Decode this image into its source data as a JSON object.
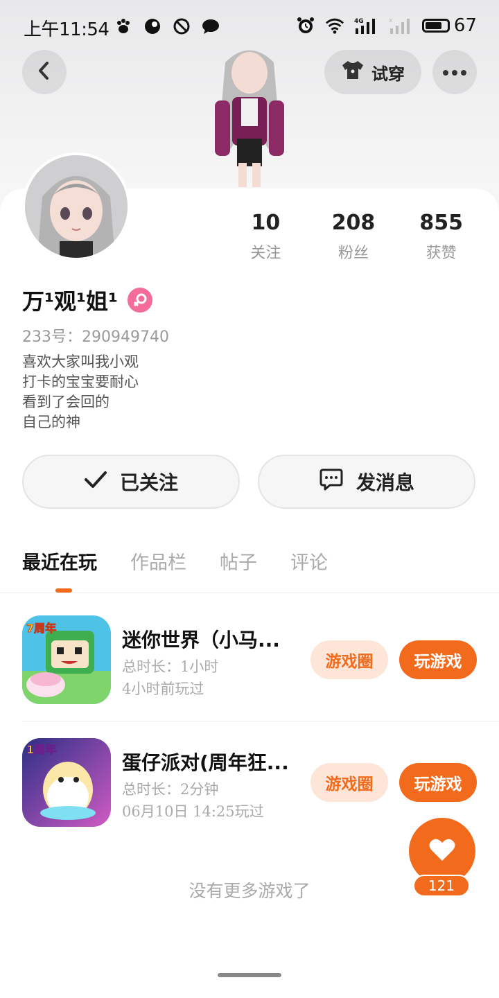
{
  "status_bar": {
    "time": "上午11:54",
    "network": "4G",
    "battery_level": "67"
  },
  "header": {
    "try_on_label": "试穿"
  },
  "profile": {
    "stats": [
      {
        "value": "10",
        "label": "关注"
      },
      {
        "value": "208",
        "label": "粉丝"
      },
      {
        "value": "855",
        "label": "获赞"
      }
    ],
    "name": "万¹观¹姐¹",
    "uid": "233号：290949740",
    "bio": [
      "喜欢大家叫我小观",
      "打卡的宝宝要耐心",
      "看到了会回的",
      "自己的神"
    ],
    "following_label": "已关注",
    "message_label": "发消息"
  },
  "tabs": [
    {
      "label": "最近在玩",
      "active": true
    },
    {
      "label": "作品栏",
      "active": false
    },
    {
      "label": "帖子",
      "active": false
    },
    {
      "label": "评论",
      "active": false
    }
  ],
  "games": [
    {
      "title": "迷你世界（小马...",
      "duration": "总时长：1小时",
      "last_played": "4小时前玩过",
      "icon_badge": "7周年",
      "circle_label": "游戏圈",
      "play_label": "玩游戏"
    },
    {
      "title": "蛋仔派对(周年狂...",
      "duration": "总时长：2分钟",
      "last_played": "06月10日  14:25玩过",
      "icon_badge": "1周年",
      "circle_label": "游戏圈",
      "play_label": "玩游戏"
    }
  ],
  "no_more_text": "没有更多游戏了",
  "like": {
    "count": "121"
  },
  "colors": {
    "accent": "#f26b1d",
    "accent_light": "#fde6d8",
    "gender_badge": "#f46d9a"
  }
}
